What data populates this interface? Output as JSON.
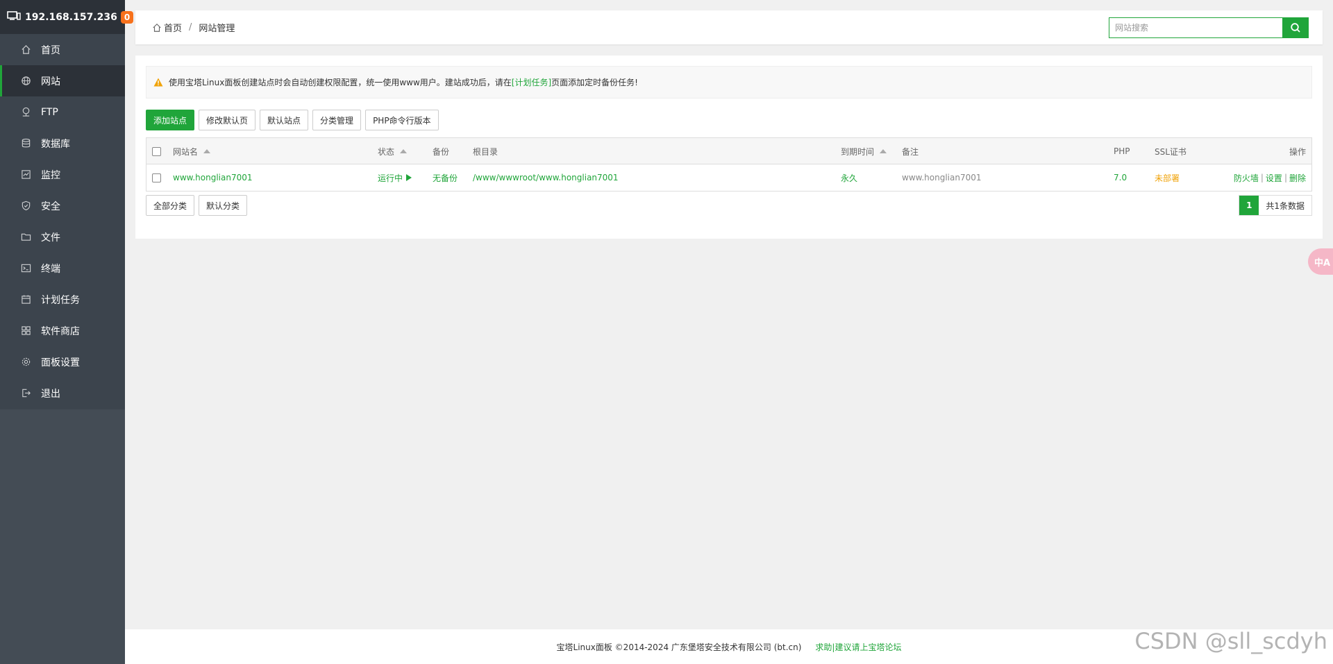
{
  "sidebar": {
    "ip": "192.168.157.236",
    "badge": "0",
    "items": [
      {
        "label": "首页",
        "icon": "home-icon"
      },
      {
        "label": "网站",
        "icon": "globe-icon"
      },
      {
        "label": "FTP",
        "icon": "ftp-icon"
      },
      {
        "label": "数据库",
        "icon": "database-icon"
      },
      {
        "label": "监控",
        "icon": "monitor-icon"
      },
      {
        "label": "安全",
        "icon": "shield-icon"
      },
      {
        "label": "文件",
        "icon": "folder-icon"
      },
      {
        "label": "终端",
        "icon": "terminal-icon"
      },
      {
        "label": "计划任务",
        "icon": "calendar-icon"
      },
      {
        "label": "软件商店",
        "icon": "apps-icon"
      },
      {
        "label": "面板设置",
        "icon": "gear-icon"
      },
      {
        "label": "退出",
        "icon": "logout-icon"
      }
    ],
    "active_index": 1
  },
  "header": {
    "breadcrumb": [
      "首页",
      "网站管理"
    ],
    "search_placeholder": "网站搜索"
  },
  "notice": {
    "prefix": "使用宝塔Linux面板创建站点时会自动创建权限配置，统一使用www用户。建站成功后，请在",
    "link": "[计划任务]",
    "suffix": "页面添加定时备份任务!"
  },
  "toolbar": {
    "add_site": "添加站点",
    "edit_default_page": "修改默认页",
    "default_site": "默认站点",
    "category_manage": "分类管理",
    "php_cli_version": "PHP命令行版本"
  },
  "table": {
    "headers": {
      "name": "网站名",
      "status": "状态",
      "backup": "备份",
      "root": "根目录",
      "expire": "到期时间",
      "remark": "备注",
      "php": "PHP",
      "ssl": "SSL证书",
      "ops": "操作"
    },
    "rows": [
      {
        "name": "www.honglian7001",
        "status": "运行中",
        "backup": "无备份",
        "root": "/www/wwwroot/www.honglian7001",
        "expire": "永久",
        "remark": "www.honglian7001",
        "php": "7.0",
        "ssl": "未部署",
        "ops_firewall": "防火墙",
        "ops_settings": "设置",
        "ops_delete": "删除",
        "ops_sep": "|"
      }
    ]
  },
  "footer_buttons": {
    "all_categories": "全部分类",
    "default_category": "默认分类"
  },
  "pagination": {
    "current": "1",
    "total": "共1条数据"
  },
  "float_button": "中A",
  "footer": {
    "copyright": "宝塔Linux面板 ©2014-2024 广东堡塔安全技术有限公司 (bt.cn)",
    "link": "求助|建议请上宝塔论坛"
  },
  "watermark": "CSDN @sll_scdyh",
  "colors": {
    "accent": "#20a53a",
    "sidebar_bg": "#3c444d",
    "sidebar_active": "#2c3138",
    "badge": "#f7711c",
    "warning": "#f0a30a"
  }
}
